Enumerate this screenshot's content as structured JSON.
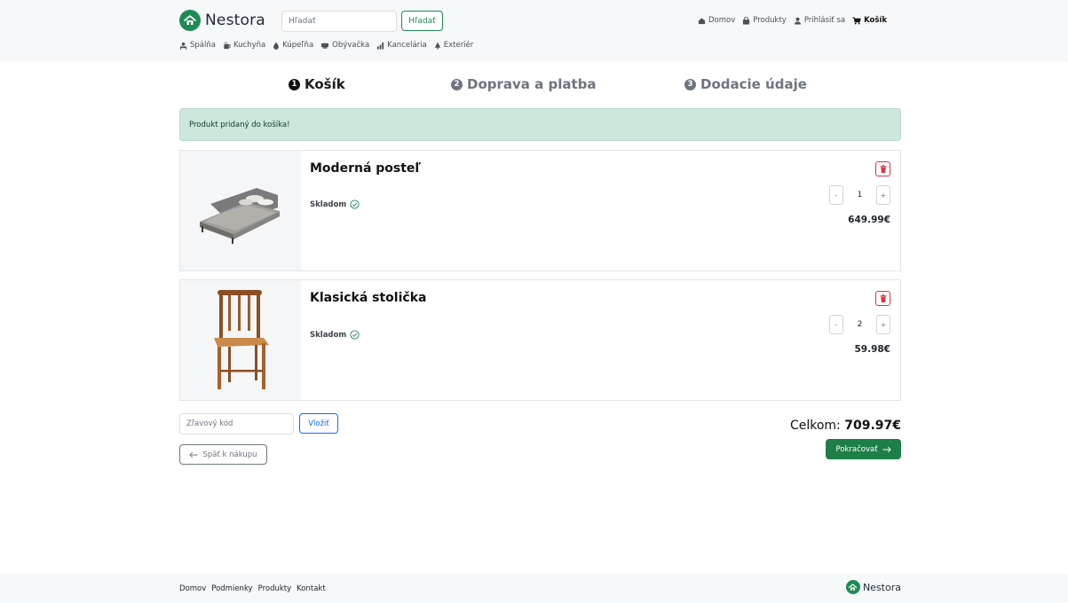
{
  "header": {
    "logo_text": "Nestora",
    "search_placeholder": "Hľadať",
    "search_button": "Hľadať",
    "nav": [
      {
        "label": "Domov",
        "icon": "home-icon"
      },
      {
        "label": "Produkty",
        "icon": "bag-icon"
      },
      {
        "label": "Prihlásiť sa",
        "icon": "user-icon"
      },
      {
        "label": "Košík",
        "icon": "cart-icon"
      }
    ],
    "categories": [
      {
        "label": "Spálňa",
        "icon": "bed-icon"
      },
      {
        "label": "Kuchyňa",
        "icon": "cup-icon"
      },
      {
        "label": "Kúpeľňa",
        "icon": "drop-icon"
      },
      {
        "label": "Obývačka",
        "icon": "sofa-icon"
      },
      {
        "label": "Kancelária",
        "icon": "chart-icon"
      },
      {
        "label": "Exteriér",
        "icon": "tree-icon"
      }
    ]
  },
  "steps": [
    {
      "num": "1",
      "label": "Košík",
      "active": true
    },
    {
      "num": "2",
      "label": "Doprava a platba",
      "active": false
    },
    {
      "num": "3",
      "label": "Dodacie údaje",
      "active": false
    }
  ],
  "alert": "Produkt pridaný do košíka!",
  "cart": {
    "items": [
      {
        "name": "Moderná posteľ",
        "stock": "Skladom",
        "qty": "1",
        "price": "649.99€",
        "qty_minus": "-",
        "qty_plus": "+"
      },
      {
        "name": "Klasická stolička",
        "stock": "Skladom",
        "qty": "2",
        "price": "59.98€",
        "qty_minus": "-",
        "qty_plus": "+"
      }
    ],
    "promo_placeholder": "Zľavový kód",
    "promo_button": "Vložiť",
    "back_button": "Späť k nákupu",
    "total_label": "Celkom:",
    "total_value": "709.97€",
    "continue_button": "Pokračovať"
  },
  "footer": {
    "links": [
      "Domov",
      "Podmienky",
      "Produkty",
      "Kontakt"
    ],
    "logo_text": "Nestora"
  },
  "colors": {
    "brand": "#1f8a55",
    "alert_bg": "#cde7dd",
    "danger": "#dc3545",
    "link_blue": "#0d6efd",
    "continue_bg": "#1e7e47"
  }
}
